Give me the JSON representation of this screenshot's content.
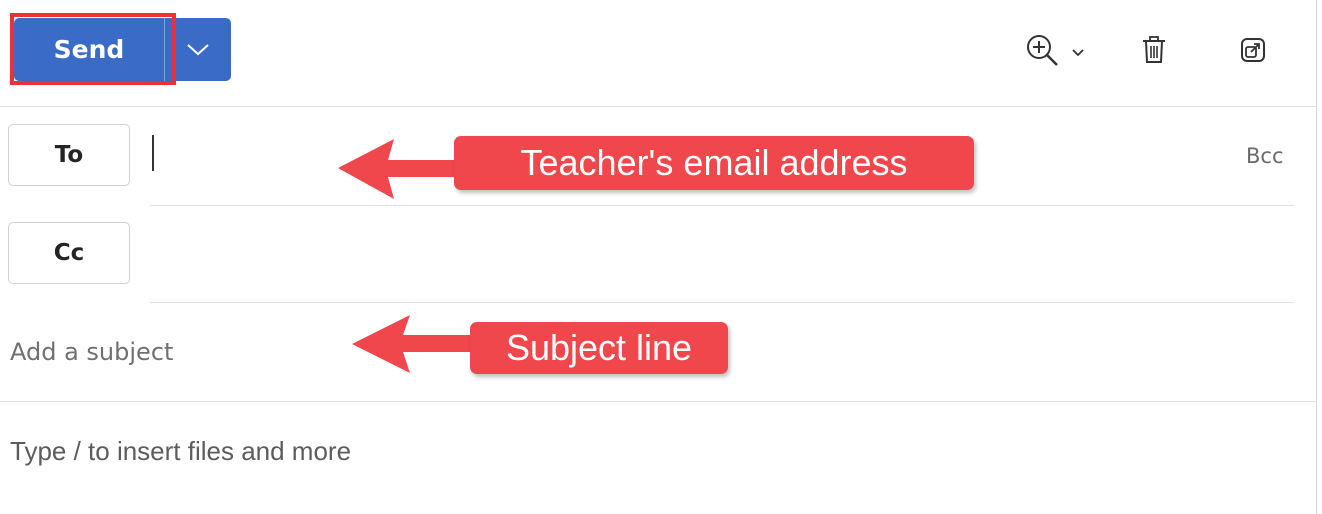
{
  "toolbar": {
    "send_label": "Send",
    "send_dropdown_icon": "chevron-down-icon",
    "zoom_icon": "zoom-in-icon",
    "delete_icon": "trash-icon",
    "popout_icon": "pop-out-icon"
  },
  "recipients": {
    "to_label": "To",
    "cc_label": "Cc",
    "bcc_label": "Bcc",
    "to_value": "",
    "cc_value": ""
  },
  "subject": {
    "placeholder": "Add a subject",
    "value": ""
  },
  "body": {
    "placeholder": "Type / to insert files and more"
  },
  "annotations": {
    "to_callout": "Teacher's email address",
    "subject_callout": "Subject line"
  },
  "colors": {
    "accent_blue": "#3a6cc7",
    "annotation_red": "#f0474d",
    "highlight_red": "#e8323a"
  }
}
